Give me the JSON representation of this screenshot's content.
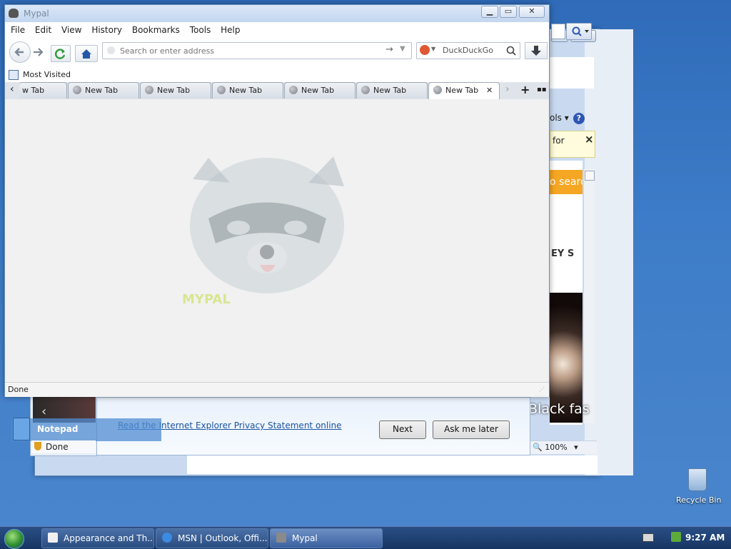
{
  "ie_window": {
    "tools_label": "ols ▾",
    "info_text": "for",
    "info_close": "×",
    "orange_text": "o search",
    "section_text": "EY   S",
    "photo_caption": "Black fas",
    "zoom": "100%",
    "status": "Done"
  },
  "ie_dialog": {
    "link": "Read the Internet Explorer Privacy Statement online",
    "next": "Next",
    "ask_later": "Ask me later"
  },
  "notepad": {
    "label": "Notepad",
    "status": "Done"
  },
  "mypal": {
    "title": "Mypal",
    "controls": {
      "minimize": "▁",
      "maximize": "▭",
      "close": "✕"
    },
    "menu": [
      "File",
      "Edit",
      "View",
      "History",
      "Bookmarks",
      "Tools",
      "Help"
    ],
    "url_placeholder": "Search or enter address",
    "search_engine": "DuckDuckGo",
    "bookmarks_label": "Most Visited",
    "tabs": [
      "w Tab",
      "New Tab",
      "New Tab",
      "New Tab",
      "New Tab",
      "New Tab",
      "New Tab"
    ],
    "tab_close": "✕",
    "new_tab": "+",
    "logo_text": "MYPAL",
    "status": "Done"
  },
  "taskbar": {
    "items": [
      "Appearance and Th...",
      "MSN | Outlook, Offi...",
      "Mypal"
    ],
    "clock": "9:27 AM"
  },
  "desktop": {
    "recycle_bin": "Recycle Bin"
  },
  "colors": {
    "desktop": "#3d7cc8",
    "taskbar": "#1f4270",
    "link": "#1a53a6",
    "ddg": "#de5833"
  }
}
